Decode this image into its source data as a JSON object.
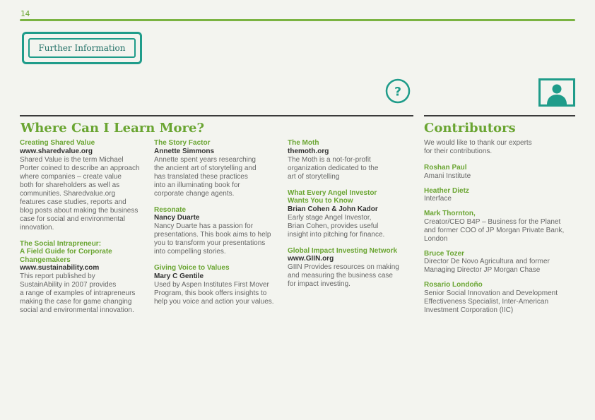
{
  "page_number": "14",
  "tab_label": "Further Information",
  "learn": {
    "title": "Where Can I Learn More?",
    "columns": [
      [
        {
          "heading": "Creating Shared Value",
          "subheading": "www.sharedvalue.org",
          "body": [
            "Shared Value is the term Michael",
            "Porter coined to describe an approach",
            "where companies – create value",
            "both for shareholders as well as",
            "communities. Sharedvalue.org",
            "features case studies, reports and",
            "blog posts about making the business",
            "case for social and environmental",
            "innovation."
          ]
        },
        {
          "heading": "The Social Intrapreneur:\nA Field Guide for Corporate\nChangemakers",
          "subheading": "www.sustainability.com",
          "body": [
            "This report published by",
            "SustainAbility in 2007 provides",
            "a range of examples of intrapreneurs",
            "making the case for game changing",
            "social and environmental innovation."
          ]
        }
      ],
      [
        {
          "heading": "The Story Factor",
          "subheading": "Annette Simmons",
          "body": [
            "Annette spent years researching",
            "the ancient art of storytelling and",
            "has translated these practices",
            "into an illuminating book for",
            "corporate change agents."
          ]
        },
        {
          "heading": "Resonate",
          "subheading": "Nancy Duarte",
          "body": [
            "Nancy Duarte has a passion for",
            "presentations. This book aims to help",
            "you to transform your presentations",
            "into compelling stories."
          ]
        },
        {
          "heading": "Giving Voice to Values",
          "subheading": "Mary C Gentile",
          "body": [
            "Used by Aspen Institutes First Mover",
            "Program, this book offers insights to",
            "help you voice and action your values."
          ]
        }
      ],
      [
        {
          "heading": "The Moth",
          "subheading": "themoth.org",
          "body": [
            "The Moth is a not-for-profit",
            "organization dedicated to the",
            "art of storytelling"
          ]
        },
        {
          "heading": "What Every Angel Investor\nWants You to Know",
          "subheading": "Brian Cohen & John Kador",
          "body": [
            "Early stage Angel Investor,",
            "Brian Cohen, provides useful",
            "insight into pitching for finance."
          ]
        },
        {
          "heading": "Global Impact Investing Network",
          "subheading": "www.GIIN.org",
          "body": [
            "GIIN Provides resources on making",
            "and measuring the business case",
            "for impact investing."
          ]
        }
      ]
    ]
  },
  "contributors": {
    "title": "Contributors",
    "intro": [
      "We would like to thank our experts",
      "for their contributions."
    ],
    "people": [
      {
        "name": "Roshan Paul",
        "role": [
          "Amani Institute"
        ]
      },
      {
        "name": "Heather Dietz",
        "role": [
          "Interface"
        ]
      },
      {
        "name": "Mark Thornton,",
        "role": [
          "Creator/CEO B4P – Business for the Planet",
          "and former COO of JP Morgan Private Bank,",
          "London"
        ]
      },
      {
        "name": "Bruce Tozer",
        "role": [
          "Director De Novo Agricultura and former",
          "Managing Director JP Morgan Chase"
        ]
      },
      {
        "name": "Rosario Londoño",
        "role": [
          "Senior Social Innovation and Development",
          "Effectiveness Specialist, Inter-American",
          "Investment Corporation (IIC)"
        ]
      }
    ]
  },
  "icons": {
    "question": "question-mark-icon",
    "contributor": "person-icon"
  },
  "colors": {
    "accent_green": "#6aa532",
    "teal": "#1f9c8a",
    "background": "#f3f4ef"
  }
}
